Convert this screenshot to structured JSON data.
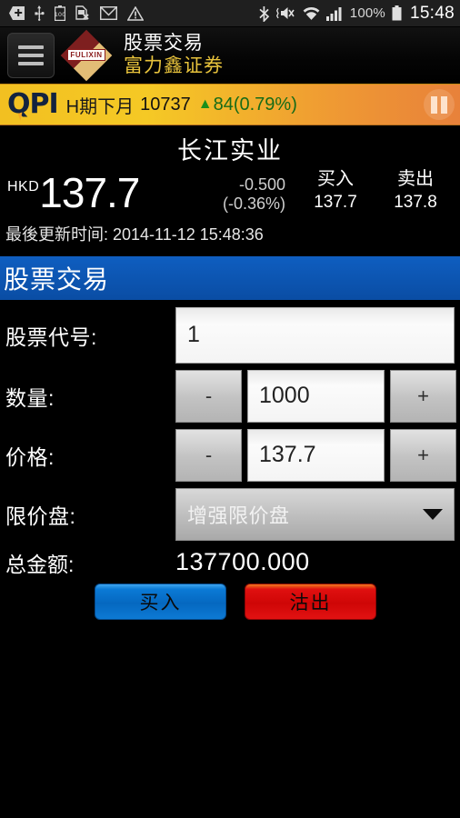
{
  "statusbar": {
    "icons_left": [
      "add-icon",
      "usb-icon",
      "battery-100-icon",
      "sim-card-error-icon",
      "gmail-icon",
      "warning-icon"
    ],
    "icons_right": [
      "bluetooth-icon",
      "mute-vibrate-icon",
      "wifi-icon",
      "signal-icon"
    ],
    "battery_percent": "100%",
    "time": "15:48"
  },
  "header": {
    "menu_icon": "hamburger-menu-icon",
    "logo_text": "FULIXIN",
    "title_main": "股票交易",
    "title_sub": "富力鑫证券"
  },
  "ticker": {
    "logo": "QPI",
    "index_name": "H期下月",
    "index_value": "10737",
    "arrow": "▲",
    "change": "84(0.79%)",
    "pause_icon": "pause-icon",
    "change_color": "#176b17"
  },
  "quote": {
    "stock_name": "长江实业",
    "currency": "HKD",
    "price": "137.7",
    "change_abs": "-0.500",
    "change_pct": "(-0.36%)",
    "bid_label": "买入",
    "bid_value": "137.7",
    "ask_label": "卖出",
    "ask_value": "137.8",
    "updated": "最後更新时间: 2014-11-12 15:48:36"
  },
  "section": {
    "title": "股票交易",
    "accent_color": "#0b57b5"
  },
  "form": {
    "code_label": "股票代号:",
    "code_value": "1",
    "qty_label": "数量:",
    "qty_value": "1000",
    "price_label": "价格:",
    "price_value": "137.7",
    "minus_label": "-",
    "plus_label": "+",
    "order_type_label": "限价盘:",
    "order_type_value": "增强限价盘",
    "total_label": "总金额:",
    "total_value": "137700.000"
  },
  "actions": {
    "buy_label": "买入",
    "sell_label": "沽出",
    "buy_color": "#0568c0",
    "sell_color": "#cf0606"
  }
}
